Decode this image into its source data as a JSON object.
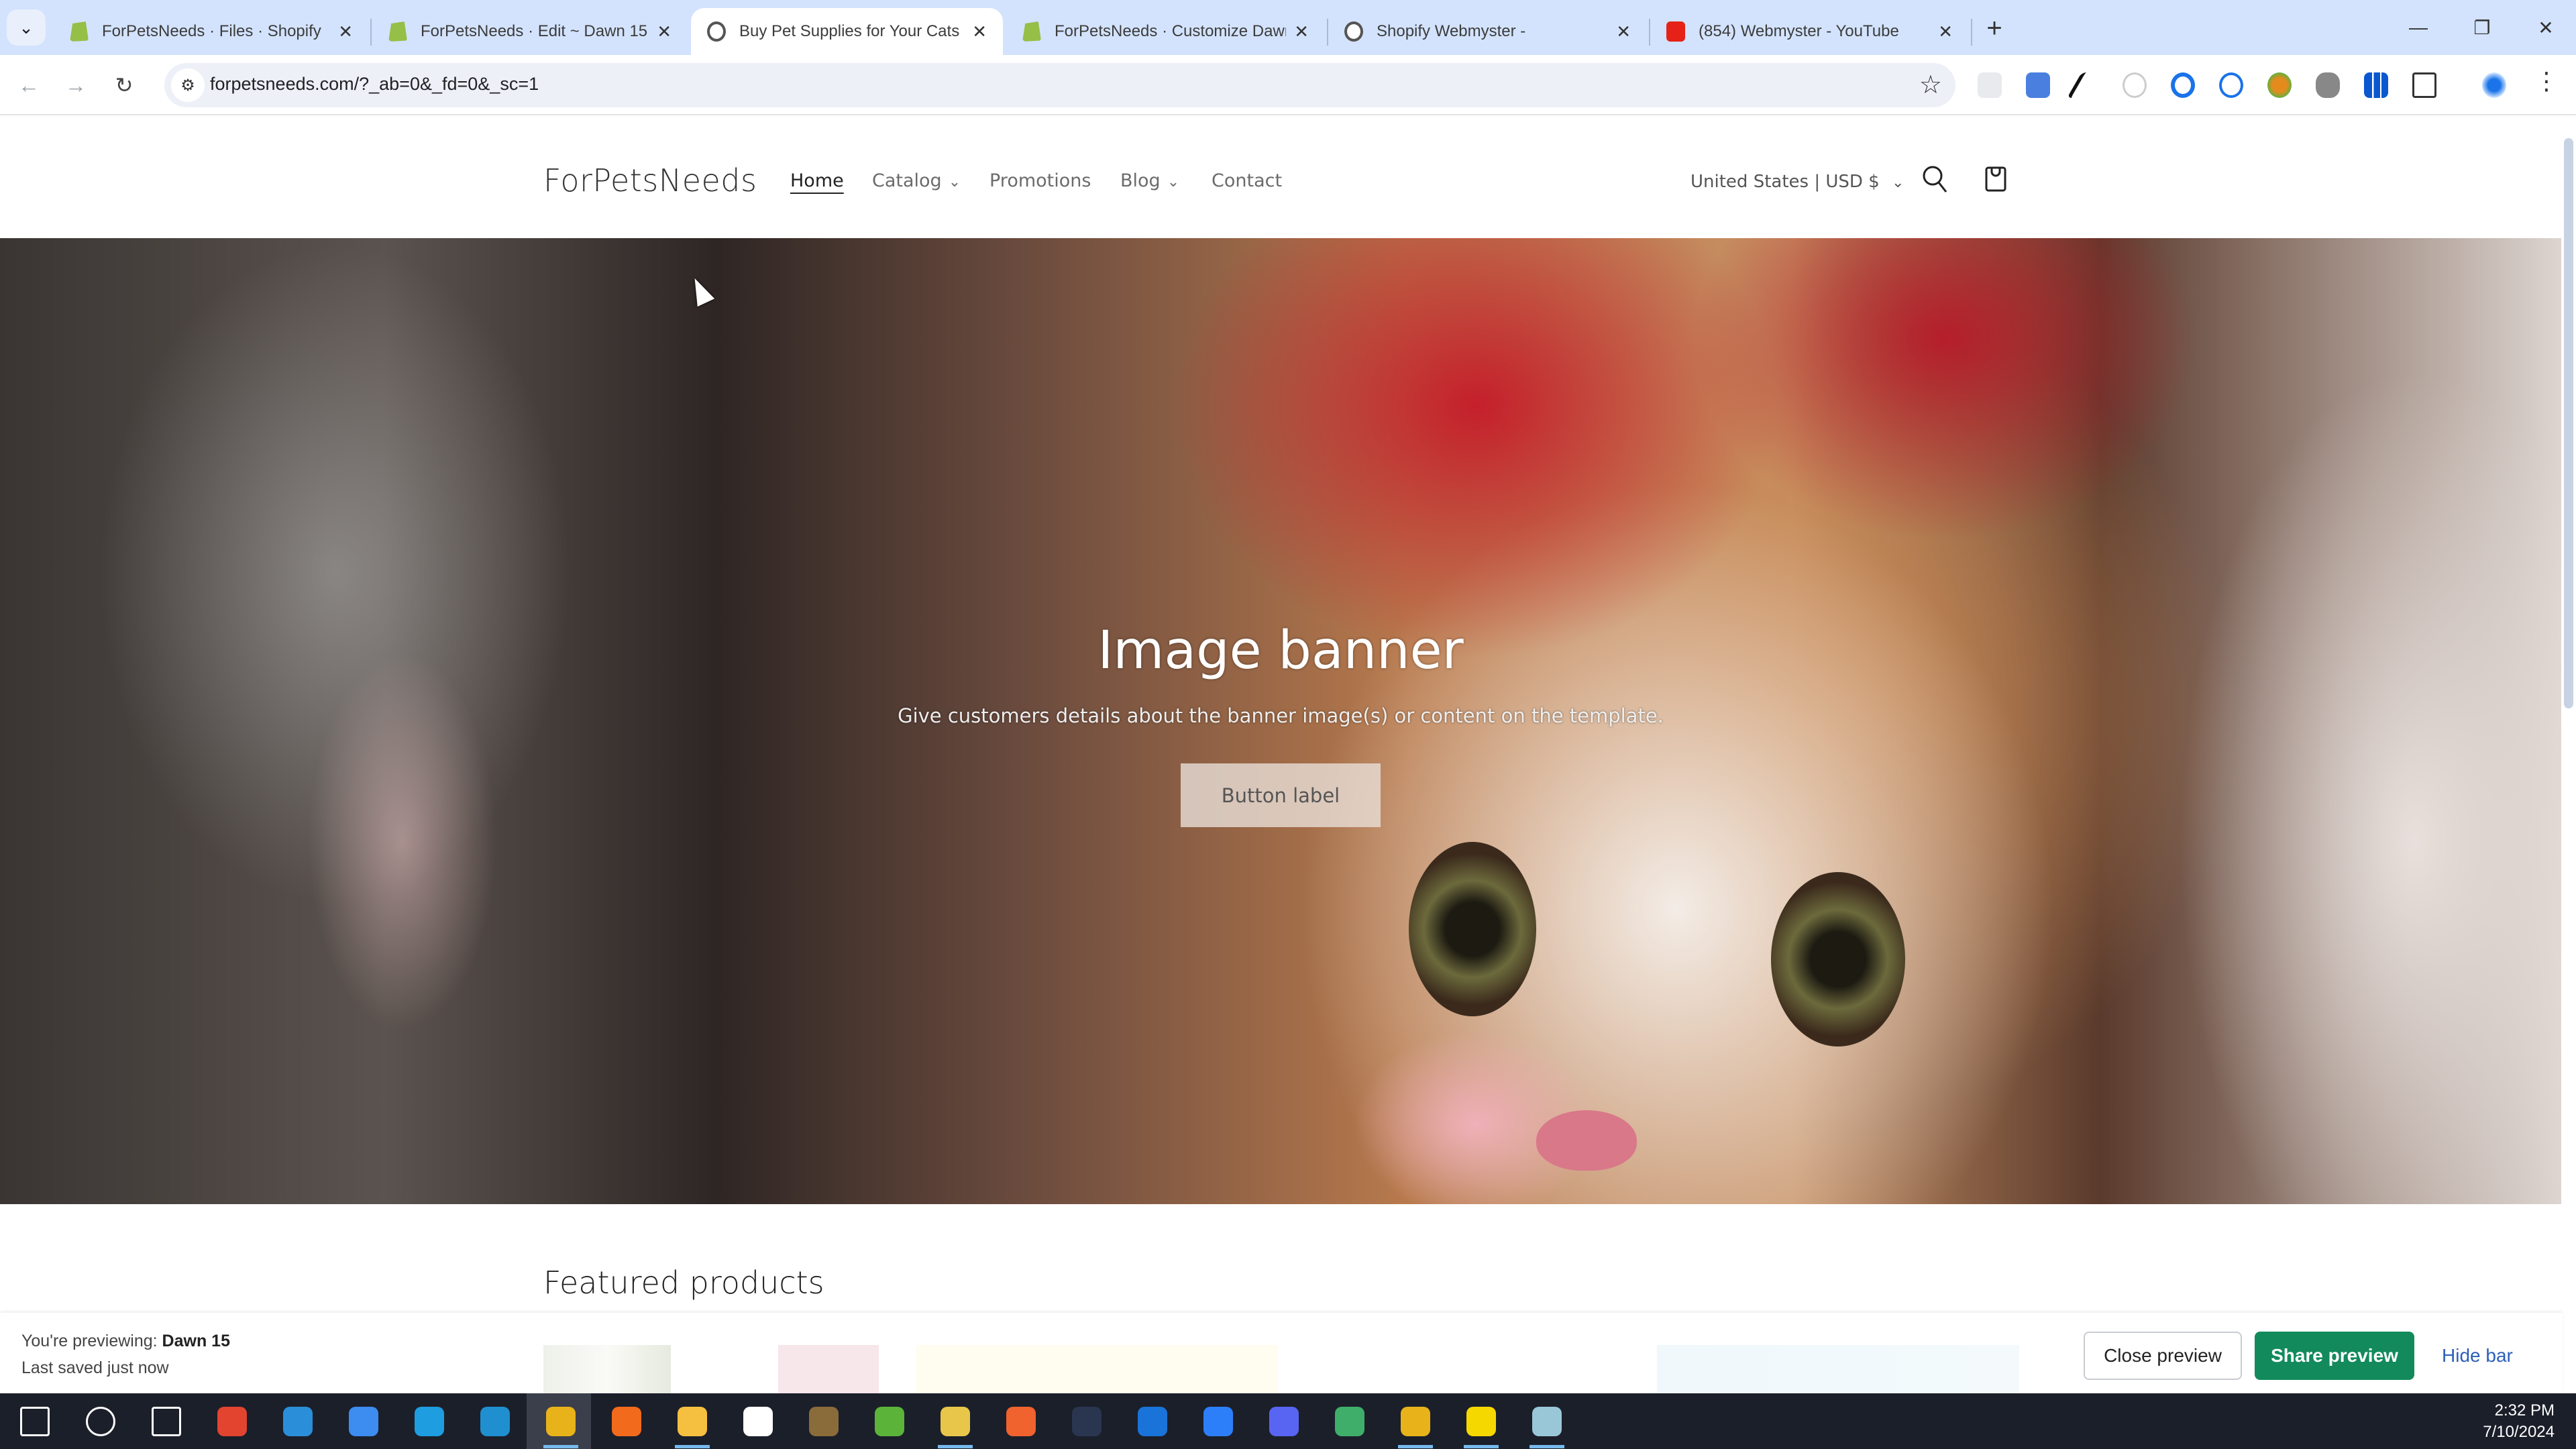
{
  "browser": {
    "tabs": [
      {
        "title": "ForPetsNeeds · Files · Shopify",
        "favicon": "shopify-icon",
        "active": false
      },
      {
        "title": "ForPetsNeeds · Edit ~ Dawn 15",
        "favicon": "shopify-icon",
        "active": false
      },
      {
        "title": "Buy Pet Supplies for Your Cats &",
        "favicon": "globe-icon",
        "active": true
      },
      {
        "title": "ForPetsNeeds · Customize Dawn",
        "favicon": "shopify-icon",
        "active": false
      },
      {
        "title": "Shopify Webmyster -",
        "favicon": "globe-icon",
        "active": false
      },
      {
        "title": "(854) Webmyster - YouTube",
        "favicon": "youtube-icon",
        "active": false
      }
    ],
    "tab_close_glyph": "✕",
    "new_tab_glyph": "+",
    "window_controls": {
      "minimize": "—",
      "restore": "❐",
      "close": "✕"
    },
    "url": "forpetsneeds.com/?_ab=0&_fd=0&_sc=1",
    "extensions": [
      "extension-1",
      "google-translate",
      "eyedropper",
      "extension-4",
      "extension-5",
      "copyright-extension",
      "extension-7",
      "extension-8",
      "extension-9",
      "extensions-puzzle",
      "profile"
    ]
  },
  "store": {
    "brand": "ForPetsNeeds",
    "nav": [
      {
        "label": "Home",
        "active": true,
        "dropdown": false
      },
      {
        "label": "Catalog",
        "active": false,
        "dropdown": true
      },
      {
        "label": "Promotions",
        "active": false,
        "dropdown": false
      },
      {
        "label": "Blog",
        "active": false,
        "dropdown": true
      },
      {
        "label": "Contact",
        "active": false,
        "dropdown": false
      }
    ],
    "locale": "United States | USD $",
    "chevron": "⌄"
  },
  "hero": {
    "title": "Image banner",
    "subtitle": "Give customers details about the banner image(s) or content on the template.",
    "button_label": "Button label"
  },
  "featured": {
    "title": "Featured products"
  },
  "preview_bar": {
    "previewing_prefix": "You're previewing: ",
    "theme_name": "Dawn 15",
    "last_saved": "Last saved just now",
    "close_label": "Close preview",
    "share_label": "Share preview",
    "hide_label": "Hide bar",
    "share_color": "#128a5c"
  },
  "taskbar": {
    "apps": [
      "start",
      "search",
      "task-view",
      "screen-recorder",
      "vscode",
      "google-ads",
      "mail",
      "edge",
      "chrome",
      "firefox",
      "file-explorer",
      "microsoft-store",
      "app-13",
      "app-14",
      "app-15",
      "app-16",
      "app-17",
      "app-18",
      "zoom",
      "discord",
      "app-21",
      "chrome-2",
      "sticky-notes",
      "app-24"
    ],
    "time": "2:32 PM",
    "date": "7/10/2024"
  }
}
